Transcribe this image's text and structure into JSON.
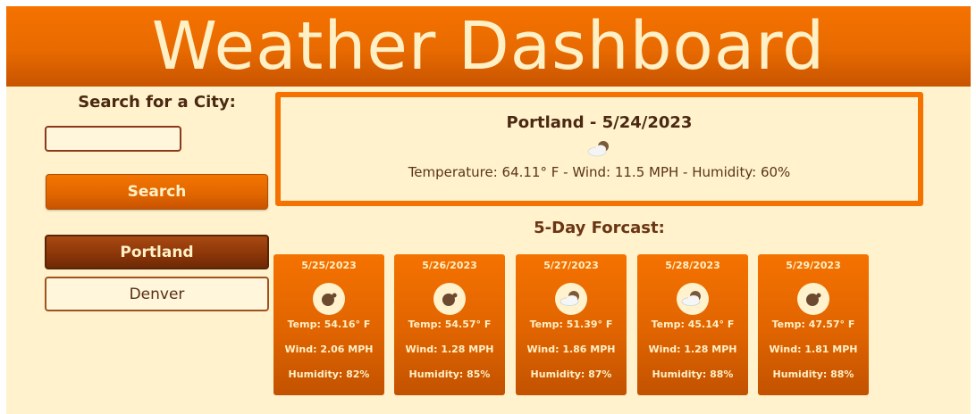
{
  "header": {
    "title": "Weather Dashboard"
  },
  "sidebar": {
    "search_label": "Search for a City:",
    "search_input_value": "",
    "search_input_placeholder": "",
    "search_button": "Search",
    "history": [
      {
        "label": "Portland",
        "active": true
      },
      {
        "label": "Denver",
        "active": false
      }
    ]
  },
  "current": {
    "title": "Portland - 5/24/2023",
    "icon": "partly-cloudy-icon",
    "details": "Temperature: 64.11° F - Wind: 11.5 MPH - Humidity: 60%"
  },
  "forecast": {
    "title": "5-Day Forcast:",
    "days": [
      {
        "date": "5/25/2023",
        "icon": "moon-icon",
        "temp": "Temp: 54.16° F",
        "wind": "Wind: 2.06 MPH",
        "humidity": "Humidity: 82%"
      },
      {
        "date": "5/26/2023",
        "icon": "moon-icon",
        "temp": "Temp: 54.57° F",
        "wind": "Wind: 1.28 MPH",
        "humidity": "Humidity: 85%"
      },
      {
        "date": "5/27/2023",
        "icon": "partly-cloudy-icon",
        "temp": "Temp: 51.39° F",
        "wind": "Wind: 1.86 MPH",
        "humidity": "Humidity: 87%"
      },
      {
        "date": "5/28/2023",
        "icon": "partly-cloudy-icon",
        "temp": "Temp: 45.14° F",
        "wind": "Wind: 1.28 MPH",
        "humidity": "Humidity: 88%"
      },
      {
        "date": "5/29/2023",
        "icon": "moon-icon",
        "temp": "Temp: 47.57° F",
        "wind": "Wind: 1.81 MPH",
        "humidity": "Humidity: 88%"
      }
    ]
  },
  "colors": {
    "header_orange": "#f57200",
    "background_cream": "#fff2cc",
    "active_brown": "#8a3508",
    "text_brown": "#4a2812"
  }
}
